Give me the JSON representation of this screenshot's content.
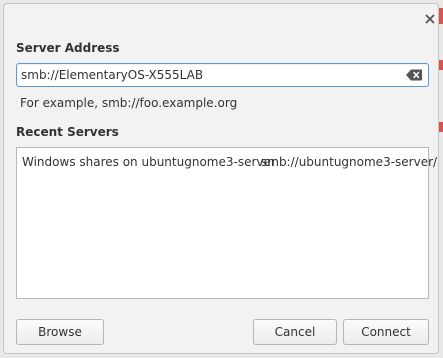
{
  "dialog": {
    "server_address_label": "Server Address",
    "address_value": "smb://ElementaryOS-X555LAB",
    "hint": "For example, smb://foo.example.org",
    "recent_label": "Recent Servers",
    "recent_servers": [
      {
        "name": "Windows shares on ubuntugnome3-server",
        "uri": "smb://ubuntugnome3-server/"
      }
    ],
    "buttons": {
      "browse": "Browse",
      "cancel": "Cancel",
      "connect": "Connect"
    }
  },
  "icons": {
    "close": "close-icon",
    "clear": "backspace-clear-icon"
  },
  "colors": {
    "focus_border": "#5b9bd5",
    "dialog_bg": "#f2f2f2"
  }
}
